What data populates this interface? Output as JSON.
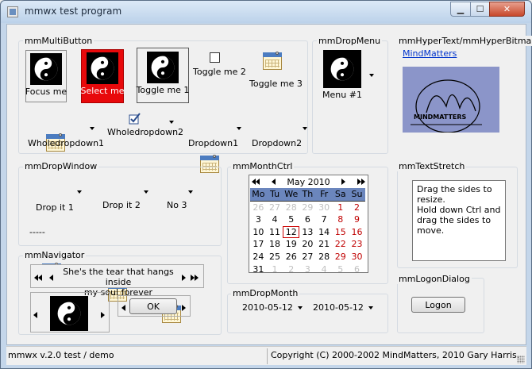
{
  "window": {
    "title": "mmwx test program"
  },
  "colors": {
    "select_red": "#e8090b",
    "calendar_header": "#6b86bd",
    "weekend": "#c00000",
    "link": "#0033cc"
  },
  "groups": {
    "multibutton": "mmMultiButton",
    "dropmenu": "mmDropMenu",
    "hyper": "mmHyperText/mmHyperBitmap",
    "dropwindow": "mmDropWindow",
    "monthctrl": "mmMonthCtrl",
    "textstretch": "mmTextStretch",
    "navigator": "mmNavigator",
    "dropmonth": "mmDropMonth",
    "logon": "mmLogonDialog"
  },
  "multibutton": {
    "focus": "Focus me",
    "select": "Select me",
    "toggle1": "Toggle me 1",
    "toggle2": "Toggle me 2",
    "toggle3": "Toggle me 3",
    "wholedropdown1": "Wholedropdown1",
    "wholedropdown2": "Wholedropdown2",
    "dropdown1": "Dropdown1",
    "dropdown2": "Dropdown2"
  },
  "dropmenu": {
    "menu1": "Menu #1"
  },
  "hyper": {
    "link": "MindMatters",
    "bitmap_text": "MINDMATTERS"
  },
  "dropwindow": {
    "drop1": "Drop it 1",
    "drop2": "Drop it 2",
    "no3": "No 3",
    "value": "-----"
  },
  "monthctrl": {
    "month_label": "May 2010",
    "days_of_week": [
      "Mo",
      "Tu",
      "We",
      "Th",
      "Fr",
      "Sa",
      "Su"
    ],
    "weeks": [
      [
        "26",
        "27",
        "28",
        "29",
        "30",
        "1",
        "2"
      ],
      [
        "3",
        "4",
        "5",
        "6",
        "7",
        "8",
        "9"
      ],
      [
        "10",
        "11",
        "12",
        "13",
        "14",
        "15",
        "16"
      ],
      [
        "17",
        "18",
        "19",
        "20",
        "21",
        "22",
        "23"
      ],
      [
        "24",
        "25",
        "26",
        "27",
        "28",
        "29",
        "30"
      ],
      [
        "31",
        "1",
        "2",
        "3",
        "4",
        "5",
        "6"
      ]
    ],
    "selected_day": "12"
  },
  "textstretch": {
    "text_line1": "Drag the sides to",
    "text_line2": "resize.",
    "text_line3": "Hold down Ctrl and",
    "text_line4": "drag the sides to",
    "text_line5": "move."
  },
  "navigator": {
    "text_line1": "She's the tear that hangs inside",
    "text_line2": "my soul forever",
    "ok_label": "OK"
  },
  "dropmonth": {
    "date1": "2010-05-12",
    "date2": "2010-05-12"
  },
  "logon": {
    "button_label": "Logon"
  },
  "status": {
    "left": "mmwx v.2.0 test / demo",
    "right": "Copyright (C) 2000-2002 MindMatters, 2010 Gary Harris."
  }
}
